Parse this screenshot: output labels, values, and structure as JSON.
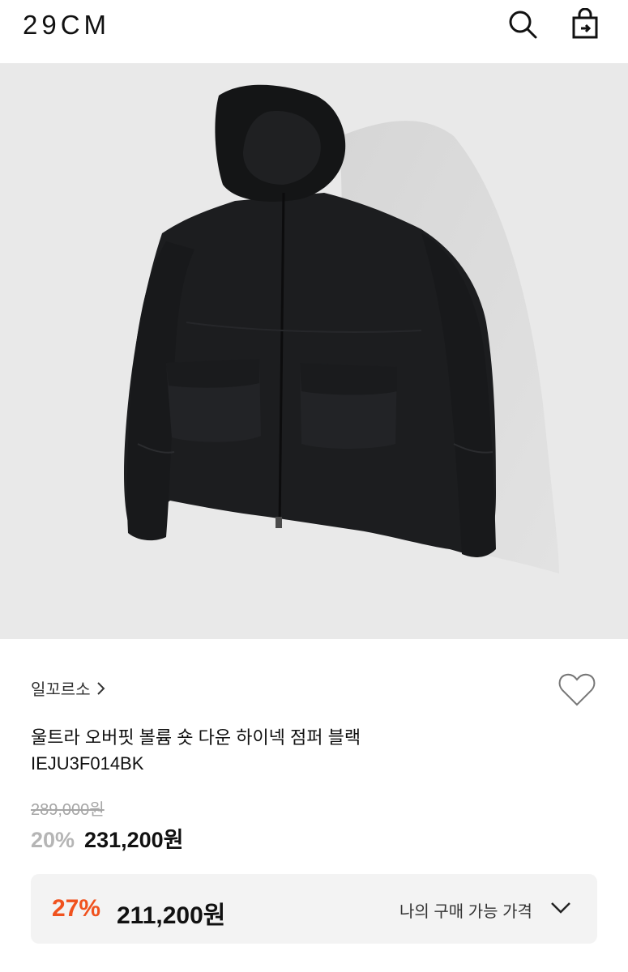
{
  "header": {
    "logo": "29CM",
    "search_icon": "search-icon",
    "bag_icon": "shopping-bag-icon"
  },
  "product": {
    "brand": "일꼬르소",
    "brand_chevron_icon": "chevron-right-icon",
    "like_icon": "heart-outline-icon",
    "title": "울트라 오버핏 볼륨 숏 다운 하이넥 점퍼 블랙",
    "code": "IEJU3F014BK",
    "original_price": "289,000원",
    "sale_percent": "20%",
    "sale_price": "231,200원"
  },
  "best_price": {
    "percent": "27%",
    "price": "211,200원",
    "label": "나의 구매 가능 가격",
    "chevron_icon": "chevron-down-icon"
  },
  "colors": {
    "accent": "#f0521e",
    "hero_bg": "#e9e9e9",
    "muted": "#a6a6a6"
  }
}
